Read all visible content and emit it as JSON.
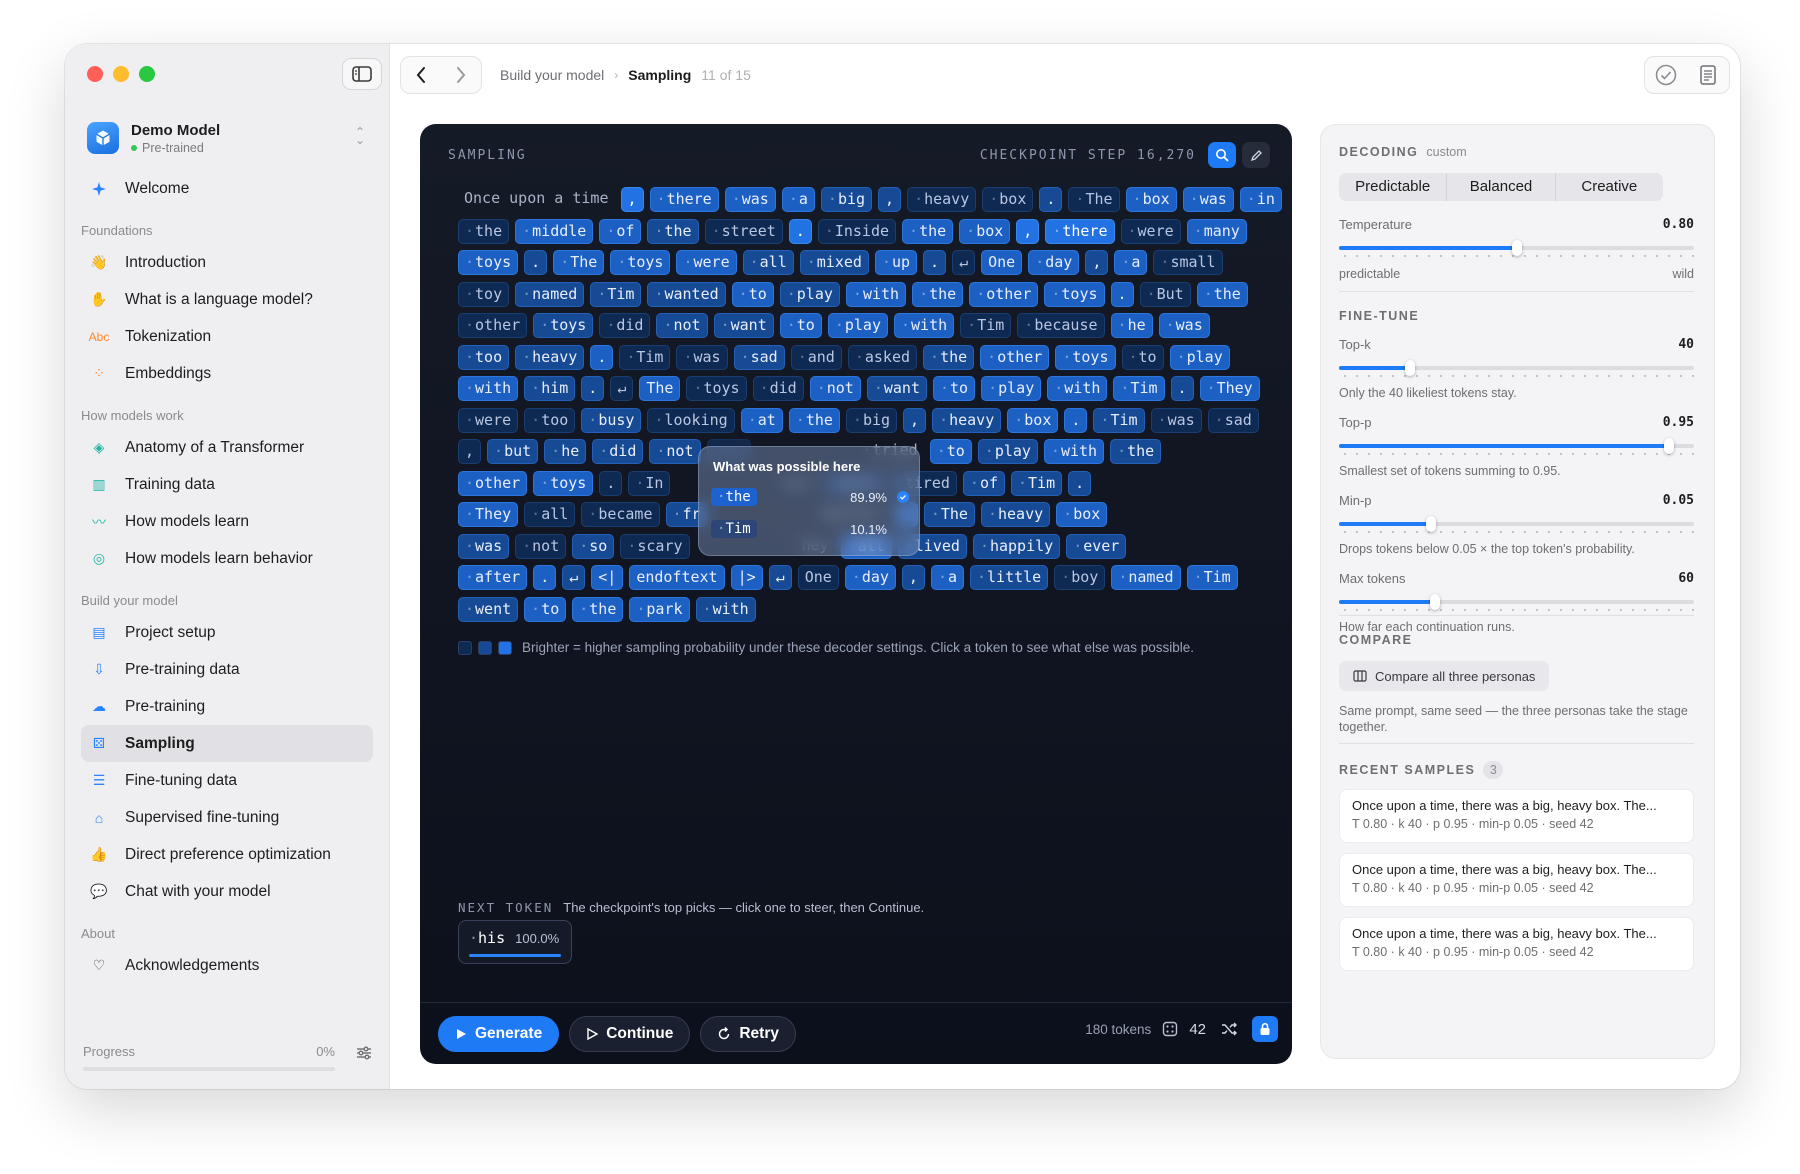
{
  "app": {
    "model_name": "Demo Model",
    "model_status": "Pre-trained"
  },
  "colors": {
    "accent": "#1f7bf5",
    "close": "#ff5f57",
    "minimize": "#febc2e",
    "zoom": "#28c840"
  },
  "sidebar": {
    "welcome": "Welcome",
    "sections": [
      {
        "title": "Foundations",
        "items": [
          {
            "label": "Introduction",
            "icon": "hand-wave-icon"
          },
          {
            "label": "What is a language model?",
            "icon": "hand-icon"
          },
          {
            "label": "Tokenization",
            "icon": "abc-icon"
          },
          {
            "label": "Embeddings",
            "icon": "dots-icon"
          }
        ]
      },
      {
        "title": "How models work",
        "items": [
          {
            "label": "Anatomy of a Transformer",
            "icon": "layers-icon"
          },
          {
            "label": "Training data",
            "icon": "bar-chart-icon"
          },
          {
            "label": "How models learn",
            "icon": "trend-icon"
          },
          {
            "label": "How models learn behavior",
            "icon": "masks-icon"
          }
        ]
      },
      {
        "title": "Build your model",
        "items": [
          {
            "label": "Project setup",
            "icon": "folder-icon"
          },
          {
            "label": "Pre-training data",
            "icon": "download-tray-icon"
          },
          {
            "label": "Pre-training",
            "icon": "brain-icon"
          },
          {
            "label": "Sampling",
            "icon": "grid-dice-icon",
            "active": true
          },
          {
            "label": "Fine-tuning data",
            "icon": "list-icon"
          },
          {
            "label": "Supervised fine-tuning",
            "icon": "graduation-cap-icon"
          },
          {
            "label": "Direct preference optimization",
            "icon": "thumbs-up-icon"
          },
          {
            "label": "Chat with your model",
            "icon": "chat-icon"
          }
        ]
      },
      {
        "title": "About",
        "items": [
          {
            "label": "Acknowledgements",
            "icon": "heart-icon"
          }
        ]
      }
    ],
    "progress_label": "Progress",
    "progress_value": "0%",
    "progress_fraction": 0
  },
  "breadcrumb": {
    "parent": "Build your model",
    "current": "Sampling",
    "position": "11 of 15"
  },
  "sampling": {
    "title": "SAMPLING",
    "checkpoint": "CHECKPOINT STEP 16,270",
    "rows": [
      [
        [
          "Once upon a time",
          0,
          0
        ],
        [
          ",",
          4,
          0
        ],
        [
          "there",
          3,
          1
        ],
        [
          "was",
          3,
          1
        ],
        [
          "a",
          3,
          1
        ],
        [
          "big",
          2,
          1
        ],
        [
          ",",
          2,
          0
        ],
        [
          "heavy",
          1,
          1
        ],
        [
          "box",
          1,
          1
        ],
        [
          ".",
          2,
          0
        ],
        [
          "The",
          1,
          1
        ],
        [
          "box",
          3,
          1
        ],
        [
          "was",
          3,
          1
        ],
        [
          "in",
          3,
          1
        ]
      ],
      [
        [
          "the",
          1,
          1
        ],
        [
          "middle",
          3,
          1
        ],
        [
          "of",
          3,
          1
        ],
        [
          "the",
          2,
          1
        ],
        [
          "street",
          1,
          1
        ],
        [
          ".",
          4,
          0
        ],
        [
          "Inside",
          1,
          1
        ],
        [
          "the",
          3,
          1
        ],
        [
          "box",
          3,
          1
        ],
        [
          ",",
          4,
          0
        ],
        [
          "there",
          4,
          1
        ],
        [
          "were",
          1,
          1
        ],
        [
          "many",
          3,
          1
        ]
      ],
      [
        [
          "toys",
          3,
          1
        ],
        [
          ".",
          2,
          0
        ],
        [
          "The",
          3,
          1
        ],
        [
          "toys",
          3,
          1
        ],
        [
          "were",
          3,
          1
        ],
        [
          "all",
          2,
          1
        ],
        [
          "mixed",
          2,
          1
        ],
        [
          "up",
          3,
          1
        ],
        [
          ".",
          2,
          0
        ],
        [
          "↵",
          1,
          0
        ],
        [
          "One",
          3,
          0
        ],
        [
          "day",
          3,
          1
        ],
        [
          ",",
          2,
          0
        ],
        [
          "a",
          3,
          1
        ],
        [
          "small",
          1,
          1
        ]
      ],
      [
        [
          "toy",
          1,
          1
        ],
        [
          "named",
          2,
          1
        ],
        [
          "Tim",
          2,
          1
        ],
        [
          "wanted",
          2,
          1
        ],
        [
          "to",
          3,
          1
        ],
        [
          "play",
          2,
          1
        ],
        [
          "with",
          3,
          1
        ],
        [
          "the",
          3,
          1
        ],
        [
          "other",
          3,
          1
        ],
        [
          "toys",
          3,
          1
        ],
        [
          ".",
          3,
          0
        ],
        [
          "But",
          1,
          1
        ],
        [
          "the",
          3,
          1
        ]
      ],
      [
        [
          "other",
          1,
          1
        ],
        [
          "toys",
          2,
          1
        ],
        [
          "did",
          1,
          1
        ],
        [
          "not",
          2,
          1
        ],
        [
          "want",
          2,
          1
        ],
        [
          "to",
          3,
          1
        ],
        [
          "play",
          3,
          1
        ],
        [
          "with",
          3,
          1
        ],
        [
          "Tim",
          1,
          1
        ],
        [
          "because",
          1,
          1
        ],
        [
          "he",
          3,
          1
        ],
        [
          "was",
          3,
          1
        ]
      ],
      [
        [
          "too",
          2,
          1
        ],
        [
          "heavy",
          2,
          1
        ],
        [
          ".",
          3,
          0
        ],
        [
          "Tim",
          1,
          1
        ],
        [
          "was",
          1,
          1
        ],
        [
          "sad",
          2,
          1
        ],
        [
          "and",
          1,
          1
        ],
        [
          "asked",
          1,
          1
        ],
        [
          "the",
          2,
          1
        ],
        [
          "other",
          3,
          1
        ],
        [
          "toys",
          3,
          1
        ],
        [
          "to",
          1,
          1
        ],
        [
          "play",
          3,
          1
        ]
      ],
      [
        [
          "with",
          3,
          1
        ],
        [
          "him",
          2,
          1
        ],
        [
          ".",
          2,
          0
        ],
        [
          "↵",
          1,
          0
        ],
        [
          "The",
          3,
          0
        ],
        [
          "toys",
          1,
          1
        ],
        [
          "did",
          1,
          1
        ],
        [
          "not",
          3,
          1
        ],
        [
          "want",
          2,
          1
        ],
        [
          "to",
          3,
          1
        ],
        [
          "play",
          3,
          1
        ],
        [
          "with",
          3,
          1
        ],
        [
          "Tim",
          3,
          1
        ],
        [
          ".",
          2,
          0
        ],
        [
          "They",
          3,
          1
        ]
      ],
      [
        [
          "were",
          1,
          1
        ],
        [
          "too",
          1,
          1
        ],
        [
          "busy",
          2,
          1
        ],
        [
          "looking",
          1,
          1
        ],
        [
          "at",
          3,
          1
        ],
        [
          "the",
          3,
          1
        ],
        [
          "big",
          1,
          1
        ],
        [
          ",",
          2,
          0
        ],
        [
          "heavy",
          2,
          1
        ],
        [
          "box",
          3,
          1
        ],
        [
          ".",
          3,
          0
        ],
        [
          "Tim",
          2,
          1
        ],
        [
          "was",
          1,
          1
        ],
        [
          "sad",
          1,
          1
        ]
      ],
      [
        [
          ",",
          1,
          0
        ],
        [
          "but",
          2,
          1
        ],
        [
          "he",
          2,
          1
        ],
        [
          "did",
          2,
          1
        ],
        [
          "not",
          2,
          1
        ],
        [
          "",
          2,
          0
        ],
        [
          "",
          0,
          0
        ],
        [
          "",
          0,
          0
        ],
        [
          "tried",
          0,
          1
        ],
        [
          "to",
          3,
          1
        ],
        [
          "play",
          2,
          1
        ],
        [
          "with",
          3,
          1
        ],
        [
          "the",
          2,
          1
        ]
      ],
      [
        [
          "other",
          3,
          1
        ],
        [
          "toys",
          3,
          1
        ],
        [
          ".",
          1,
          0
        ],
        [
          "In",
          1,
          1
        ],
        [
          "",
          0,
          0
        ],
        [
          "",
          0,
          0
        ],
        [
          "oys",
          0,
          0
        ],
        [
          "were",
          1,
          1
        ],
        [
          "tired",
          1,
          1
        ],
        [
          "of",
          2,
          1
        ],
        [
          "Tim",
          2,
          1
        ],
        [
          ".",
          2,
          0
        ]
      ],
      [
        [
          "They",
          3,
          1
        ],
        [
          "all",
          1,
          1
        ],
        [
          "became",
          1,
          1
        ],
        [
          "fr",
          2,
          1
        ],
        [
          "",
          0,
          0
        ],
        [
          "",
          0,
          0
        ],
        [
          "ogether",
          0,
          0
        ],
        [
          ".",
          3,
          0
        ],
        [
          "The",
          2,
          1
        ],
        [
          "heavy",
          2,
          1
        ],
        [
          "box",
          3,
          1
        ]
      ],
      [
        [
          "was",
          2,
          1
        ],
        [
          "not",
          1,
          1
        ],
        [
          "so",
          2,
          1
        ],
        [
          "scary",
          1,
          1
        ],
        [
          "",
          0,
          0
        ],
        [
          "",
          0,
          0
        ],
        [
          "hey",
          0,
          0
        ],
        [
          "all",
          3,
          1
        ],
        [
          "lived",
          2,
          1
        ],
        [
          "happily",
          2,
          1
        ],
        [
          "ever",
          2,
          1
        ]
      ],
      [
        [
          "after",
          3,
          1
        ],
        [
          ".",
          3,
          0
        ],
        [
          "↵",
          2,
          0
        ],
        [
          "<|",
          3,
          0
        ],
        [
          "endoftext",
          3,
          0
        ],
        [
          "|>",
          3,
          0
        ],
        [
          "↵",
          2,
          0
        ],
        [
          "One",
          1,
          0
        ],
        [
          "day",
          3,
          1
        ],
        [
          ",",
          2,
          0
        ],
        [
          "a",
          3,
          1
        ],
        [
          "little",
          2,
          1
        ],
        [
          "boy",
          1,
          1
        ],
        [
          "named",
          3,
          1
        ],
        [
          "Tim",
          3,
          1
        ]
      ],
      [
        [
          "went",
          2,
          1
        ],
        [
          "to",
          3,
          1
        ],
        [
          "the",
          3,
          1
        ],
        [
          "park",
          3,
          1
        ],
        [
          "with",
          2,
          1
        ]
      ]
    ],
    "legend": "Brighter = higher sampling probability under these decoder settings. Click a token to see what else was possible.",
    "popup": {
      "title": "What was possible here",
      "options": [
        {
          "token": "the",
          "prob": "89.9%",
          "selected": true
        },
        {
          "token": "Tim",
          "prob": "10.1%"
        }
      ]
    },
    "next_token_heading": "NEXT TOKEN",
    "next_token_hint": "The checkpoint's top picks — click one to steer, then Continue.",
    "next_token": {
      "token": "his",
      "prob": "100.0%",
      "fraction": 1.0
    },
    "generate": "Generate",
    "continue": "Continue",
    "retry": "Retry",
    "token_count": "180 tokens",
    "seed": "42"
  },
  "decoding": {
    "heading": "DECODING",
    "mode": "custom",
    "presets": [
      "Predictable",
      "Balanced",
      "Creative"
    ],
    "temperature": {
      "label": "Temperature",
      "value": "0.80",
      "fraction": 0.5,
      "min_label": "predictable",
      "max_label": "wild"
    }
  },
  "finetune": {
    "heading": "FINE-TUNE",
    "params": [
      {
        "label": "Top-k",
        "value": "40",
        "fraction": 0.2,
        "note": "Only the 40 likeliest tokens stay."
      },
      {
        "label": "Top-p",
        "value": "0.95",
        "fraction": 0.93,
        "note": "Smallest set of tokens summing to 0.95."
      },
      {
        "label": "Min-p",
        "value": "0.05",
        "fraction": 0.26,
        "note": "Drops tokens below 0.05 × the top token's probability."
      },
      {
        "label": "Max tokens",
        "value": "60",
        "fraction": 0.27,
        "note": "How far each continuation runs."
      }
    ]
  },
  "compare": {
    "heading": "COMPARE",
    "button": "Compare all three personas",
    "note": "Same prompt, same seed — the three personas take the stage together."
  },
  "recent": {
    "heading": "RECENT SAMPLES",
    "count": "3",
    "samples": [
      {
        "text": "Once upon a time, there was a big, heavy box. The...",
        "meta": "T 0.80 · k 40 · p 0.95 · min-p 0.05 · seed 42"
      },
      {
        "text": "Once upon a time, there was a big, heavy box. The...",
        "meta": "T 0.80 · k 40 · p 0.95 · min-p 0.05 · seed 42"
      },
      {
        "text": "Once upon a time, there was a big, heavy box. The...",
        "meta": "T 0.80 · k 40 · p 0.95 · min-p 0.05 · seed 42"
      }
    ]
  }
}
